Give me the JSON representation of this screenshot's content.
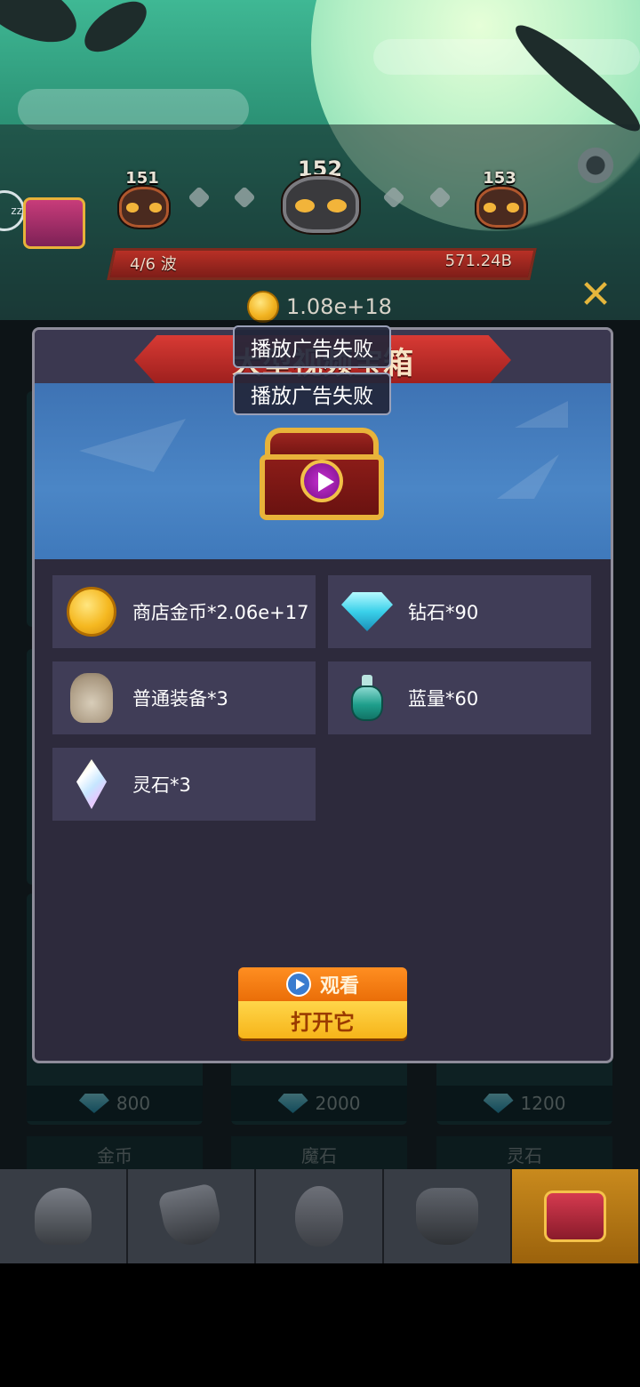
{
  "level": {
    "prev": "151",
    "current": "152",
    "next": "153"
  },
  "wave": {
    "label": "4/6 波",
    "value": "571.24B",
    "progress": 1.0
  },
  "coins": "1.08e+18",
  "modal": {
    "title": "大型视频宝箱",
    "rewards": [
      {
        "label": "商店金币*2.06e+17",
        "icon": "gold-coin-icon"
      },
      {
        "label": "钻石*90",
        "icon": "diamond-icon"
      },
      {
        "label": "普通装备*3",
        "icon": "equipment-sack-icon"
      },
      {
        "label": "蓝量*60",
        "icon": "mana-potion-icon"
      },
      {
        "label": "灵石*3",
        "icon": "spirit-stone-icon"
      }
    ],
    "watch_label": "观看",
    "open_label": "打开它"
  },
  "toasts": [
    "播放广告失败",
    "播放广告失败"
  ],
  "shop": {
    "prices": [
      "800",
      "2000",
      "1200"
    ],
    "tags": [
      "金币",
      "魔石",
      "灵石"
    ]
  },
  "nav": {
    "tabs": [
      {
        "icon": "helmet-icon",
        "active": false
      },
      {
        "icon": "shield-sword-icon",
        "active": false
      },
      {
        "icon": "egg-icon",
        "active": false
      },
      {
        "icon": "armor-icon",
        "active": false
      },
      {
        "icon": "treasure-chest-icon",
        "active": true
      }
    ]
  },
  "colors": {
    "accent": "#f6b419",
    "modal_bg": "#2d2a3c",
    "banner": "#4b86c6"
  }
}
